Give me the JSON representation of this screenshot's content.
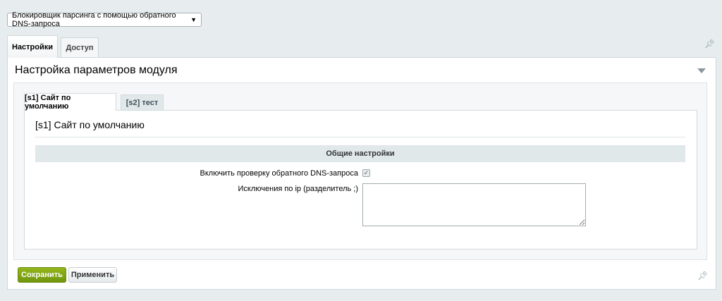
{
  "module_select": {
    "value": "Блокировщик парсинга с помощью обратного DNS-запроса"
  },
  "tabs": [
    {
      "label": "Настройки",
      "active": true
    },
    {
      "label": "Доступ",
      "active": false
    }
  ],
  "panel": {
    "title": "Настройка параметров модуля"
  },
  "site_tabs": [
    {
      "label": "[s1] Сайт по умолчанию",
      "active": true
    },
    {
      "label": "[s2] тест",
      "active": false
    }
  ],
  "content": {
    "title": "[s1] Сайт по умолчанию",
    "section": "Общие настройки",
    "fields": [
      {
        "label": "Включить проверку обратного DNS-запроса",
        "type": "checkbox",
        "checked": true
      },
      {
        "label": "Исключения по ip (разделитель ;)",
        "type": "textarea",
        "value": ""
      }
    ]
  },
  "buttons": {
    "save": "Сохранить",
    "apply": "Применить"
  },
  "colors": {
    "save": "#7aa014",
    "background": "#e7edef"
  }
}
